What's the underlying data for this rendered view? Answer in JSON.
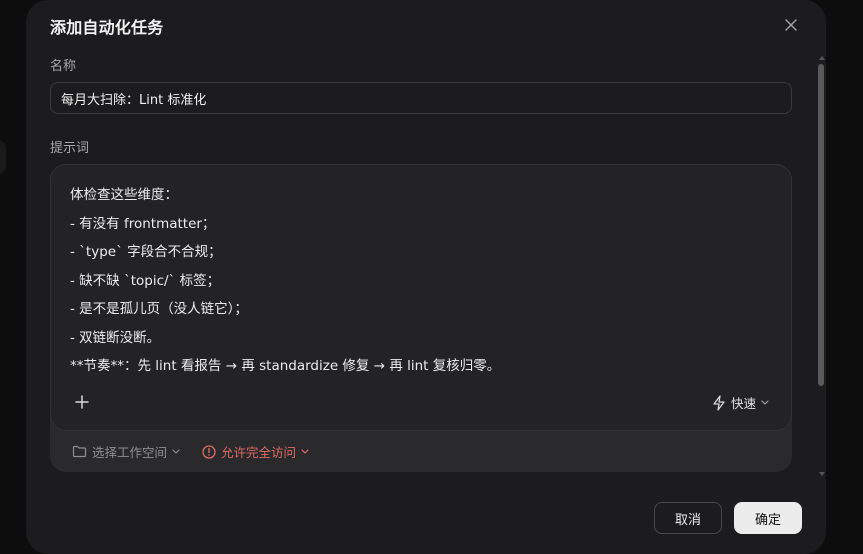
{
  "dialog": {
    "title": "添加自动化任务",
    "name_label": "名称",
    "name_value": "每月大扫除：Lint 标准化",
    "prompt_label": "提示词",
    "prompt_lines": [
      "体检查这些维度：",
      "- 有没有 frontmatter；",
      "- `type` 字段合不合规；",
      "- 缺不缺 `topic/` 标签；",
      "- 是不是孤儿页（没人链它）；",
      "- 双链断没断。",
      "**节奏**：先 lint 看报告 → 再 standardize 修复 → 再 lint 复核归零。"
    ],
    "speed_label": "快速",
    "workspace_label": "选择工作空间",
    "access_label": "允许完全访问",
    "cancel_label": "取消",
    "ok_label": "确定"
  },
  "icons": {
    "close": "close-icon",
    "add": "plus-icon",
    "speed": "lightning-icon",
    "folder": "folder-icon",
    "warning": "alert-circle-icon",
    "chevron": "chevron-down-icon"
  },
  "colors": {
    "modal_bg": "#1c1c1e",
    "warning": "#e06b63",
    "primary_button": "#ececec"
  }
}
